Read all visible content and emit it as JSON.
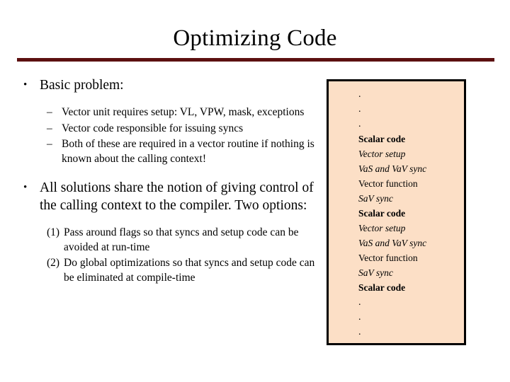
{
  "slide": {
    "title": "Optimizing Code",
    "rule_color": "#5C1010"
  },
  "body": {
    "bullet1": {
      "marker": "•",
      "text": "Basic problem:",
      "sub_items": [
        {
          "marker": "–",
          "text": "Vector unit requires setup: VL, VPW, mask, exceptions"
        },
        {
          "marker": "–",
          "text": "Vector code responsible for issuing syncs"
        },
        {
          "marker": "–",
          "text": "Both of these are required in a vector routine if nothing is known about the calling context!"
        }
      ]
    },
    "bullet2": {
      "marker": "•",
      "text": "All solutions share the notion of giving control of the calling context to the compiler.  Two options:",
      "numbered_items": [
        {
          "marker": "(1)",
          "text": "Pass around flags so that syncs and setup code can be avoided at run-time"
        },
        {
          "marker": "(2)",
          "text": "Do global optimizations so that syncs and setup code can be eliminated at compile-time"
        }
      ]
    }
  },
  "code_panel": {
    "background_color": "#FCDFC6",
    "border_color": "#000000",
    "lines": [
      {
        "text": ".",
        "style": "dot"
      },
      {
        "text": ".",
        "style": "dot"
      },
      {
        "text": ".",
        "style": "dot"
      },
      {
        "text": "Scalar code",
        "style": "bold"
      },
      {
        "text": "Vector setup",
        "style": "italic"
      },
      {
        "text": "VaS and VaV sync",
        "style": "italic"
      },
      {
        "text": "Vector function",
        "style": "regular"
      },
      {
        "text": "SaV sync",
        "style": "italic"
      },
      {
        "text": "Scalar code",
        "style": "bold"
      },
      {
        "text": "Vector setup",
        "style": "italic"
      },
      {
        "text": "VaS and VaV sync",
        "style": "italic"
      },
      {
        "text": "Vector function",
        "style": "regular"
      },
      {
        "text": "SaV sync",
        "style": "italic"
      },
      {
        "text": "Scalar code",
        "style": "bold"
      },
      {
        "text": ".",
        "style": "dot"
      },
      {
        "text": ".",
        "style": "dot"
      },
      {
        "text": ".",
        "style": "dot"
      }
    ]
  }
}
